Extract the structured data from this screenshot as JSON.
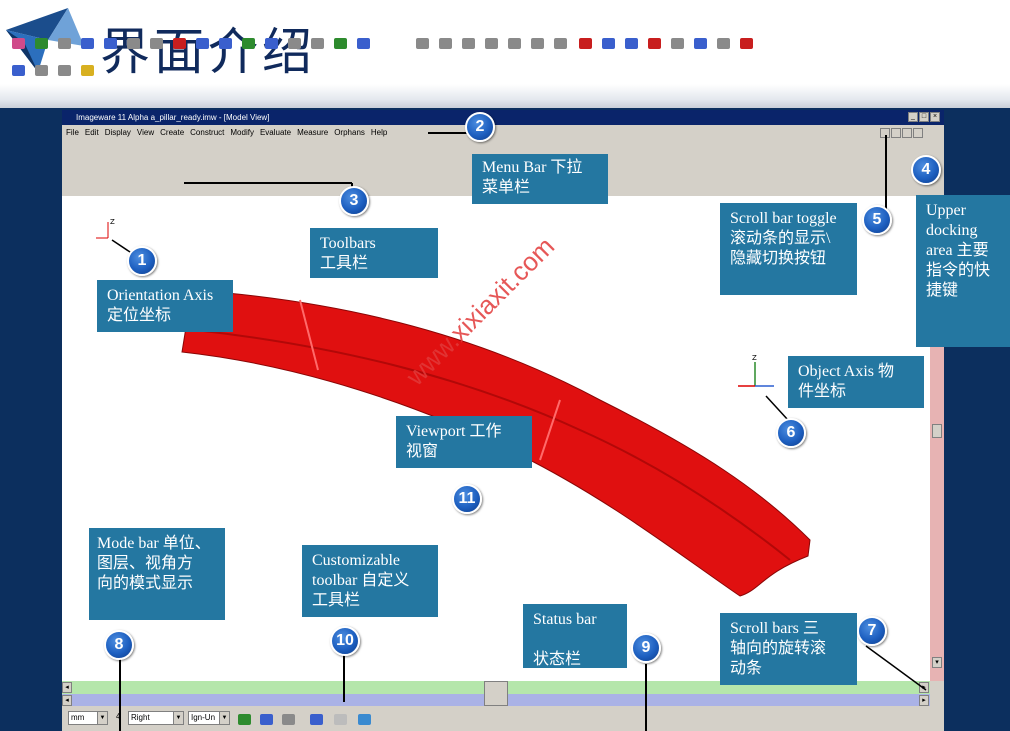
{
  "slide": {
    "title": "界面介绍"
  },
  "window": {
    "title": "Imageware 11 Alpha a_pillar_ready.imw - [Model View]",
    "controls": [
      "_",
      "□",
      "×"
    ]
  },
  "menubar": {
    "items": [
      "File",
      "Edit",
      "Display",
      "View",
      "Create",
      "Construct",
      "Modify",
      "Evaluate",
      "Measure",
      "Orphans",
      "Help"
    ]
  },
  "toolbar_icons": {
    "row1": [
      "pink",
      "green",
      "gray",
      "blue",
      "blue",
      "gray",
      "gray",
      "red",
      "blue",
      "blue",
      "green",
      "blue",
      "gray",
      "gray",
      "green",
      "blue"
    ],
    "row1b": [
      "gray",
      "gray",
      "gray",
      "gray",
      "gray",
      "gray",
      "gray"
    ],
    "row1c": [
      "red",
      "blue",
      "blue",
      "red",
      "gray",
      "blue",
      "gray",
      "red"
    ],
    "row2": [
      "blue",
      "gray",
      "gray",
      "yellow"
    ]
  },
  "modebar": {
    "units": "mm",
    "layer": "4",
    "view": "Right",
    "mode": "Ign-Un"
  },
  "callouts": {
    "menu_bar": "Menu Bar  下拉\n菜单栏",
    "toolbars": "Toolbars\n    工具栏",
    "scroll_toggle": "Scroll bar toggle\n滚动条的显示\\\n隐藏切换按钮",
    "upper_dock": "    Upper\ndocking\narea  主要\n指令的快\n捷键",
    "orientation_axis": "Orientation Axis\n定位坐标",
    "object_axis": "Object Axis   物\n件坐标",
    "viewport": "Viewport   工作\n视窗",
    "mode_bar": " Mode bar  单位、\n图层、视角方\n向的模式显示",
    "custom_toolbar": "Customizable\ntoolbar  自定义\n工具栏",
    "status_bar": "Status bar\n\n   状态栏",
    "scroll_bars": "Scroll bars    三\n轴向的旋转滚\n动条"
  },
  "badges": [
    "1",
    "2",
    "3",
    "4",
    "5",
    "6",
    "7",
    "8",
    "9",
    "10",
    "11"
  ],
  "watermark": "www.xixiaxit.com",
  "colors": {
    "panel": "#0c2f5e",
    "callout": "#2477a1",
    "model": "#e01010",
    "title": "#102a5c"
  }
}
